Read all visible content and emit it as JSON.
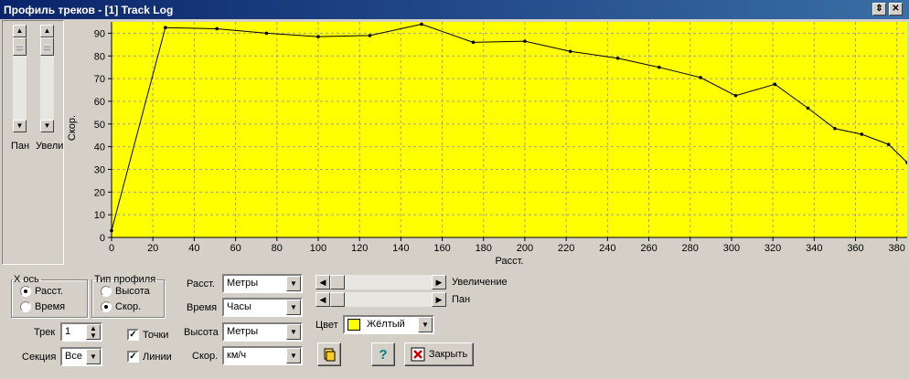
{
  "window": {
    "title": "Профиль треков - [1] Track Log"
  },
  "left_panel": {
    "pan_label": "Пан",
    "zoom_label": "Увели"
  },
  "chart_data": {
    "type": "line",
    "title": "",
    "xlabel": "Расст.",
    "ylabel": "Скор.",
    "xlim": [
      0,
      385
    ],
    "ylim": [
      0,
      95
    ],
    "x_ticks": [
      0,
      20,
      40,
      60,
      80,
      100,
      120,
      140,
      160,
      180,
      200,
      220,
      240,
      260,
      280,
      300,
      320,
      340,
      360,
      380
    ],
    "y_ticks": [
      0,
      10,
      20,
      30,
      40,
      50,
      60,
      70,
      80,
      90
    ],
    "grid": true,
    "background_color": "#ffff00",
    "line_color": "#000000",
    "series": [
      {
        "x": [
          0,
          26,
          51,
          75,
          100,
          125,
          150,
          175,
          200,
          222,
          245,
          265,
          285,
          302,
          321,
          337,
          350,
          363,
          376,
          385
        ],
        "y": [
          3,
          92.5,
          92,
          90,
          88.5,
          89,
          94,
          86,
          86.5,
          82,
          79,
          75,
          70.5,
          62.5,
          67.5,
          57,
          48,
          45.5,
          41,
          33
        ]
      }
    ]
  },
  "x_axis_group": {
    "legend": "X ось",
    "options": [
      "Расст.",
      "Время"
    ],
    "selected": 0
  },
  "profile_group": {
    "legend": "Тип профиля",
    "options": [
      "Высота",
      "Скор."
    ],
    "selected": 1
  },
  "units": {
    "distance_label": "Расст.",
    "distance_value": "Метры",
    "time_label": "Время",
    "time_value": "Часы",
    "altitude_label": "Высота",
    "altitude_value": "Метры",
    "speed_label": "Скор.",
    "speed_value": "км/ч"
  },
  "sliders": {
    "zoom_label": "Увеличение",
    "pan_label": "Пан"
  },
  "color": {
    "label": "Цвет",
    "value": "Жёлтый",
    "swatch": "#ffff00"
  },
  "track": {
    "label": "Трек",
    "value": "1"
  },
  "section": {
    "label": "Секция",
    "value": "Все"
  },
  "options": {
    "points_label": "Точки",
    "points_checked": true,
    "lines_label": "Линии",
    "lines_checked": true
  },
  "buttons": {
    "help_label": "?",
    "close_label": "Закрыть"
  }
}
